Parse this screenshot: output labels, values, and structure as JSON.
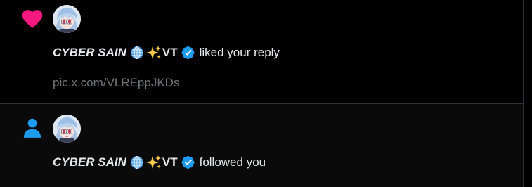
{
  "colors": {
    "background": "#000000",
    "heart": "#f91880",
    "person": "#1d9bf0",
    "verified": "#1d9bf0",
    "muted_text": "#71767b",
    "divider": "#2f3336"
  },
  "notifications": [
    {
      "type_icon": "heart-icon",
      "user": {
        "name": "CYBER SAIN",
        "suffix": "VT",
        "avatar": "anime-avatar"
      },
      "action": "liked your reply",
      "link": "pic.x.com/VLREppJKDs"
    },
    {
      "type_icon": "person-icon",
      "user": {
        "name": "CYBER SAIN",
        "suffix": "VT",
        "avatar": "anime-avatar"
      },
      "action": "followed you"
    }
  ]
}
